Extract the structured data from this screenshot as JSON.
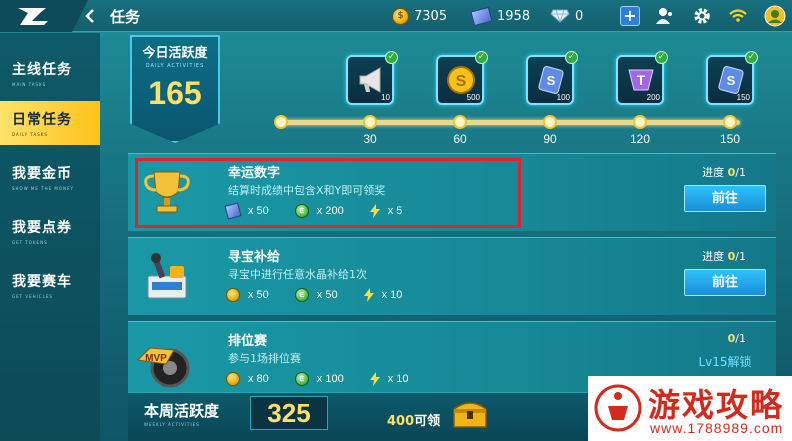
{
  "topbar": {
    "title": "任务",
    "coins": "7305",
    "tickets": "1958",
    "gems": "0"
  },
  "sidebar": {
    "items": [
      {
        "label": "主线任务",
        "sub": "MAIN TASKS",
        "active": false
      },
      {
        "label": "日常任务",
        "sub": "DAILY TASKS",
        "active": true
      },
      {
        "label": "我要金币",
        "sub": "SHOW ME THE MONEY",
        "active": false
      },
      {
        "label": "我要点券",
        "sub": "GET TOKENS",
        "active": false
      },
      {
        "label": "我要赛车",
        "sub": "GET VEHICLES",
        "active": false
      }
    ]
  },
  "daily": {
    "title": "今日活跃度",
    "sub": "DAILY ACTIVITIES",
    "value": "165"
  },
  "milestones": [
    {
      "threshold": "30",
      "reward_count": "10",
      "icon": "horn-icon",
      "claimed": true
    },
    {
      "threshold": "60",
      "reward_count": "500",
      "icon": "gold-coin-icon",
      "claimed": true
    },
    {
      "threshold": "90",
      "reward_count": "100",
      "icon": "s-card-icon",
      "claimed": true
    },
    {
      "threshold": "120",
      "reward_count": "200",
      "icon": "t-gem-icon",
      "claimed": true
    },
    {
      "threshold": "150",
      "reward_count": "150",
      "icon": "s-card-icon",
      "claimed": true
    }
  ],
  "tasks": [
    {
      "title": "幸运数字",
      "desc": "结算时成绩中包含X和Y即可领奖",
      "icon": "trophy-icon",
      "rewards": [
        {
          "icon": "ticket-icon",
          "amount": "x 50"
        },
        {
          "icon": "e-coin-icon",
          "amount": "x 200"
        },
        {
          "icon": "bolt-icon",
          "amount": "x 5"
        }
      ],
      "progress_label": "进度",
      "progress_current": "0",
      "progress_total": "/1",
      "action": "前往"
    },
    {
      "title": "寻宝补给",
      "desc": "寻宝中进行任意水晶补给1次",
      "icon": "treasure-machine-icon",
      "rewards": [
        {
          "icon": "gold-coin-icon",
          "amount": "x 50"
        },
        {
          "icon": "e-coin-icon",
          "amount": "x 50"
        },
        {
          "icon": "bolt-icon",
          "amount": "x 10"
        }
      ],
      "progress_label": "进度",
      "progress_current": "0",
      "progress_total": "/1",
      "action": "前往"
    },
    {
      "title": "排位赛",
      "desc": "参与1场排位赛",
      "icon": "mvp-tire-icon",
      "rewards": [
        {
          "icon": "gold-coin-icon",
          "amount": "x 80"
        },
        {
          "icon": "e-coin-icon",
          "amount": "x 100"
        },
        {
          "icon": "bolt-icon",
          "amount": "x 10"
        }
      ],
      "progress_label": "",
      "progress_current": "0",
      "progress_total": "/1",
      "action": "Lv15解锁"
    }
  ],
  "weekly": {
    "title": "本周活跃度",
    "sub": "WEEKLY ACTIVITIES",
    "value": "325",
    "claim_amount": "400",
    "claim_label": "可领"
  },
  "watermark": {
    "text": "游戏攻略",
    "url": "www.1788989.com"
  },
  "colors": {
    "accent_yellow": "#ffe066",
    "button_blue": "#1a8fd6",
    "highlight_red": "#e0242b",
    "bg_teal": "#16707f"
  }
}
